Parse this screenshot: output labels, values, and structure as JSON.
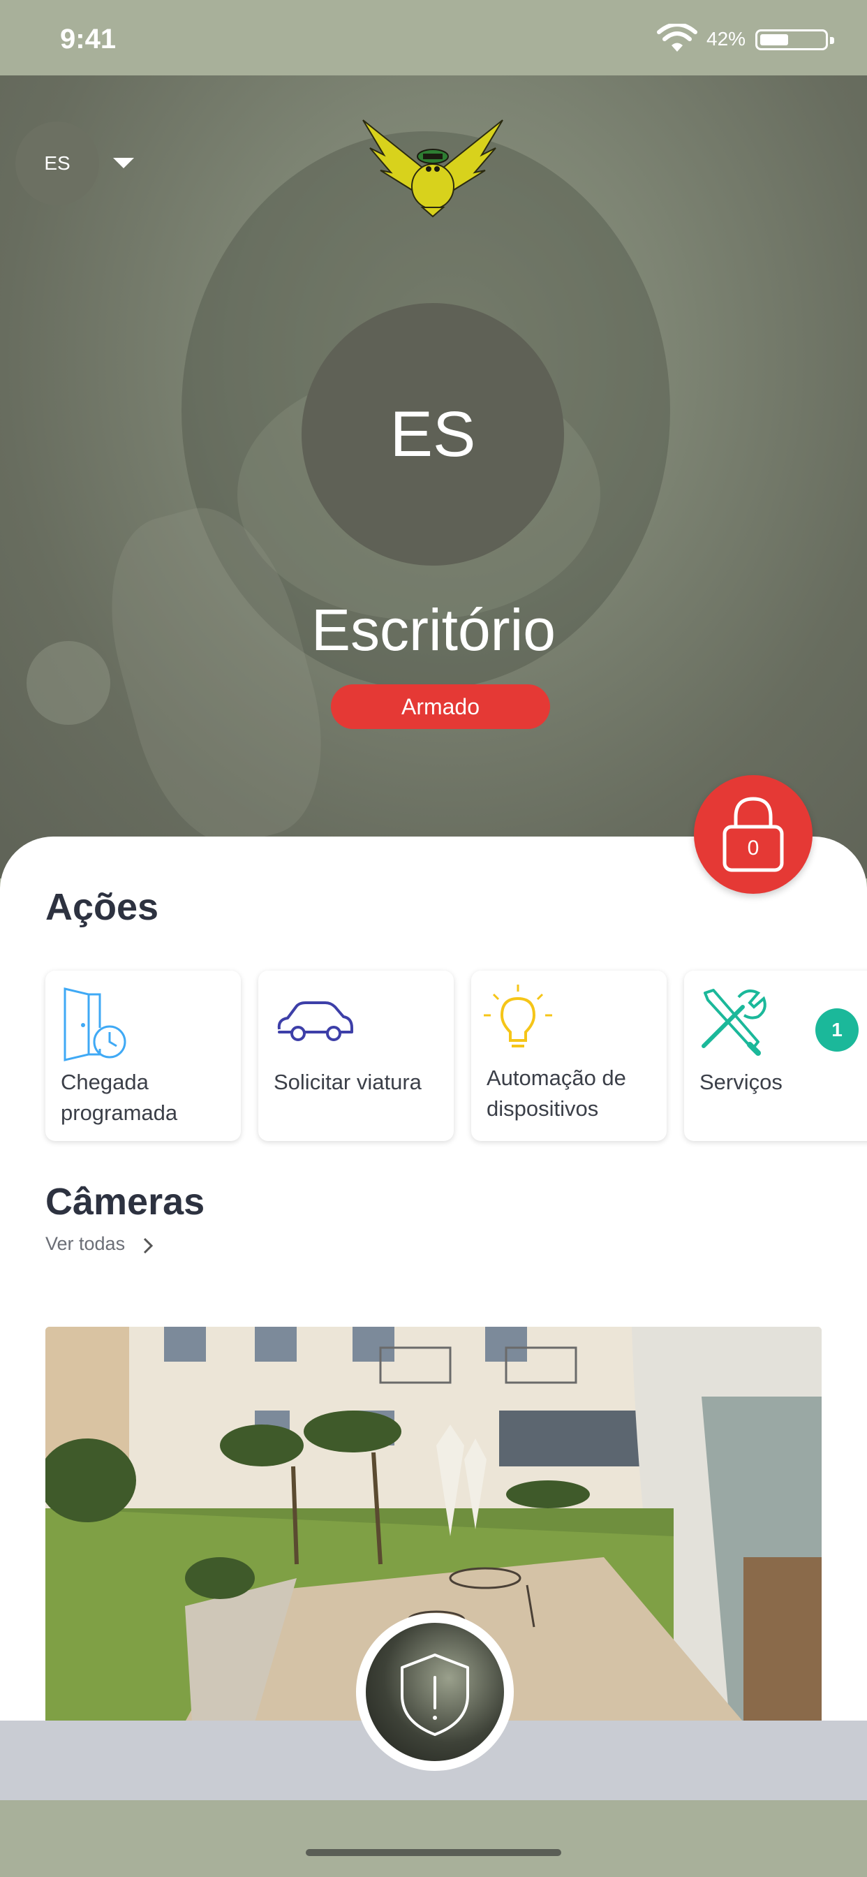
{
  "status_bar": {
    "time": "9:41",
    "battery_percent": "42%"
  },
  "header": {
    "site_initials": "ES"
  },
  "profile": {
    "initials": "ES",
    "site_name": "Escritório",
    "status": "Armado"
  },
  "lock": {
    "count": "0"
  },
  "actions": {
    "title": "Ações",
    "items": [
      {
        "label": "Chegada programada",
        "icon": "door-clock-icon"
      },
      {
        "label": "Solicitar viatura",
        "icon": "car-icon"
      },
      {
        "label": "Automação de dispositivos",
        "icon": "lightbulb-icon"
      },
      {
        "label": "Serviços",
        "icon": "tools-icon",
        "badge": "1"
      }
    ]
  },
  "cameras": {
    "title": "Câmeras",
    "see_all": "Ver todas"
  },
  "colors": {
    "accent_red": "#e53935",
    "badge_green": "#1bb89a",
    "status_bg": "#a8b09a"
  }
}
